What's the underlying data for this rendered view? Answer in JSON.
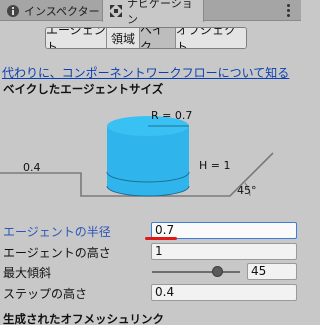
{
  "window_tabs": [
    {
      "label": "インスペクター",
      "icon": "info-icon"
    },
    {
      "label": "ナビゲーション",
      "icon": "navigation-icon"
    }
  ],
  "sub_tabs": [
    "エージェント",
    "領域",
    "ベイク",
    "オブジェクト"
  ],
  "active_sub_tab": "ベイク",
  "help_link": "代わりに、コンポーネントワークフローについて知る",
  "baked_agent_size": {
    "title": "ベイクしたエージェントサイズ",
    "radius_label": "R = 0.7",
    "height_label": "H = 1",
    "step_label": "0.4",
    "slope_label": "45°"
  },
  "fields": {
    "radius": {
      "label": "エージェントの半径",
      "value": "0.7"
    },
    "height": {
      "label": "エージェントの高さ",
      "value": "1"
    },
    "max_slope": {
      "label": "最大傾斜",
      "value": "45",
      "level": 0.75
    },
    "step_height": {
      "label": "ステップの高さ",
      "value": "0.4"
    }
  },
  "generated_offmesh_title": "生成されたオフメッシュリンク",
  "colors": {
    "cylinder": "#2fb4ec",
    "cylinder_top": "#39c0f2",
    "focus_border": "#3b7dd8",
    "underline": "#e01818",
    "link": "#0b3fb0"
  }
}
